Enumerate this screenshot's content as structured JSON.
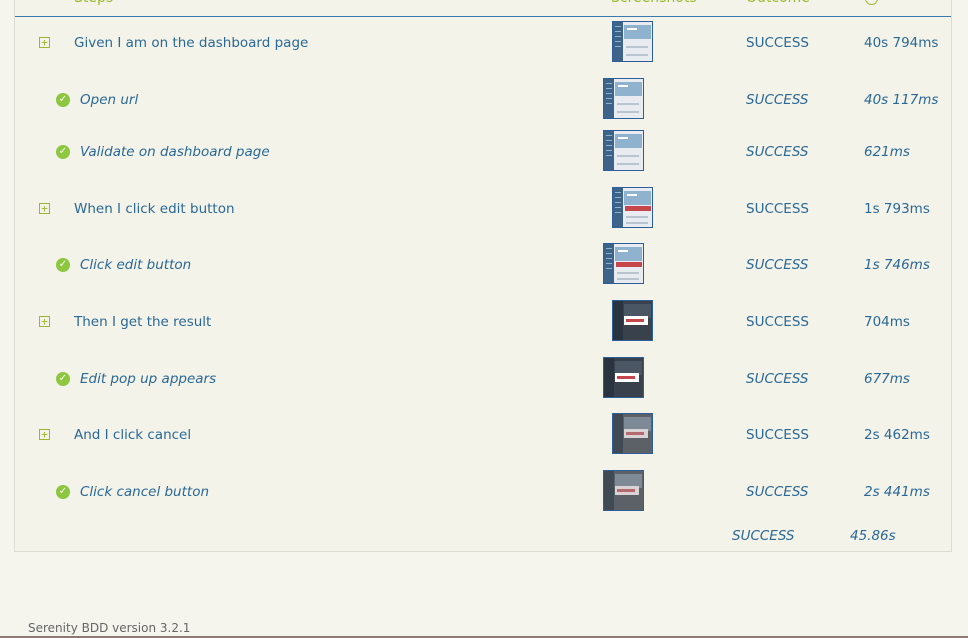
{
  "header": {
    "steps_label": "Steps",
    "screenshots_label": "Screenshots",
    "outcome_label": "Outcome"
  },
  "rows": [
    {
      "level": "top",
      "title": "Given I am on the dashboard page",
      "outcome": "SUCCESS",
      "duration": "40s 794ms"
    },
    {
      "level": "sub",
      "title": "Open url",
      "outcome": "SUCCESS",
      "duration": "40s 117ms"
    },
    {
      "level": "sub",
      "title": "Validate on dashboard page",
      "outcome": "SUCCESS",
      "duration": "621ms"
    },
    {
      "level": "top",
      "title": "When I click edit button",
      "outcome": "SUCCESS",
      "duration": "1s 793ms"
    },
    {
      "level": "sub",
      "title": "Click edit button",
      "outcome": "SUCCESS",
      "duration": "1s 746ms"
    },
    {
      "level": "top",
      "title": "Then I get the result",
      "outcome": "SUCCESS",
      "duration": "704ms"
    },
    {
      "level": "sub",
      "title": "Edit pop up appears",
      "outcome": "SUCCESS",
      "duration": "677ms"
    },
    {
      "level": "top",
      "title": "And I click cancel",
      "outcome": "SUCCESS",
      "duration": "2s 462ms"
    },
    {
      "level": "sub",
      "title": "Click cancel button",
      "outcome": "SUCCESS",
      "duration": "2s 441ms"
    }
  ],
  "total": {
    "outcome": "SUCCESS",
    "duration": "45.86s"
  },
  "footer": {
    "version_text": "Serenity BDD version 3.2.1"
  },
  "icons": {
    "expand": "expand-plus-icon",
    "success": "success-check-icon",
    "duration_header": "clock-icon"
  },
  "colors": {
    "accent_green": "#9ab82e",
    "text_blue": "#2a6896",
    "check_green": "#8dc63f",
    "header_line": "#3a79ab"
  }
}
